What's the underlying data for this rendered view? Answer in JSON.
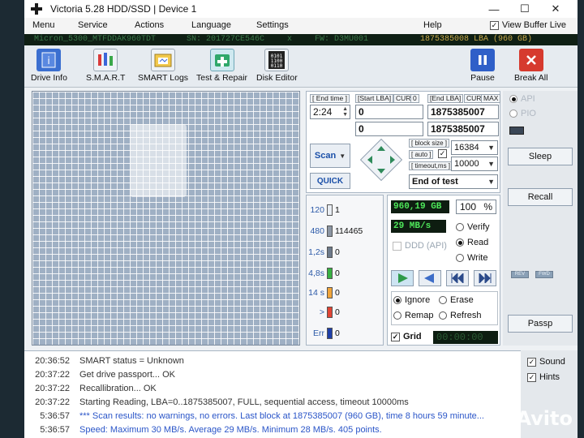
{
  "window": {
    "title": "Victoria 5.28 HDD/SSD | Device 1",
    "buttons": [
      "—",
      "☐",
      "✕"
    ]
  },
  "menu": [
    "Menu",
    "Service",
    "Actions",
    "Language",
    "Settings",
    "Help"
  ],
  "view_buffer": {
    "label": "View Buffer Live",
    "checked": true
  },
  "device": {
    "model": "Micron_5300_MTFDDAK960TDT",
    "serial": "SN: 201727CE546C",
    "sep": "x",
    "firmware": "FW: D3MU001",
    "lba": "1875385008 LBA (960 GB)"
  },
  "toolbar": {
    "drive_info": "Drive Info",
    "smart": "S.M.A.R.T",
    "smart_logs": "SMART Logs",
    "test_repair": "Test & Repair",
    "disk_editor": "Disk Editor",
    "pause": "Pause",
    "break_all": "Break All"
  },
  "controls": {
    "end_time_label": "[ End time ]",
    "end_time_value": "2:24",
    "start_lba_label": "[Start LBA]",
    "cur_label": "CUR",
    "start_cur_value": "0",
    "end_lba_label": "[End LBA]",
    "max_label": "MAX",
    "start_lba_value": "0",
    "end_lba_value": "1875385007",
    "cur_value": "0",
    "end_lba_cur_value": "1875385007",
    "scan_button": "Scan",
    "quick_button": "QUICK",
    "block_size_label": "[ block size ]",
    "auto_label": "[ auto ]",
    "block_size_value": "16384",
    "timeout_label": "[ timeout,ms ]",
    "timeout_value": "10000",
    "end_action": "End of test"
  },
  "stats": [
    {
      "label": "120",
      "color": "#e8edf3",
      "value": "1"
    },
    {
      "label": "480",
      "color": "#8c96a3",
      "value": "114465"
    },
    {
      "label": "1,2s",
      "color": "#6d7a8a",
      "value": "0"
    },
    {
      "label": "4,8s",
      "color": "#38b043",
      "value": "0"
    },
    {
      "label": "14 s",
      "color": "#f0a43a",
      "value": "0"
    },
    {
      "label": ">",
      "color": "#e04434",
      "value": "0"
    },
    {
      "label": "Err",
      "color": "#1e3fa8",
      "value": "0"
    }
  ],
  "info": {
    "size": "960,19 GB",
    "percent": "100",
    "percent_sign": "%",
    "speed": "29 MB/s",
    "ddd_api": "DDD (API)",
    "mode_verify": "Verify",
    "mode_read": "Read",
    "mode_write": "Write",
    "action_ignore": "Ignore",
    "action_erase": "Erase",
    "action_remap": "Remap",
    "action_refresh": "Refresh",
    "grid_label": "Grid",
    "timer": "00:00:00"
  },
  "right_panel": {
    "api": "API",
    "pio": "PIO",
    "sleep": "Sleep",
    "recall": "Recall",
    "mini1": "REV",
    "mini2": "FWD",
    "passp": "Passp",
    "sound": "Sound",
    "hints": "Hints"
  },
  "log": [
    {
      "time": "20:36:52",
      "msg": "SMART status = Unknown",
      "blue": false
    },
    {
      "time": "20:37:22",
      "msg": "Get drive passport... OK",
      "blue": false
    },
    {
      "time": "20:37:22",
      "msg": "Recallibration... OK",
      "blue": false
    },
    {
      "time": "20:37:22",
      "msg": "Starting Reading, LBA=0..1875385007, FULL, sequential access, timeout 10000ms",
      "blue": false
    },
    {
      "time": "5:36:57",
      "msg": "*** Scan results: no warnings, no errors. Last block at 1875385007 (960 GB), time 8 hours 59 minute...",
      "blue": true
    },
    {
      "time": "5:36:57",
      "msg": "Speed: Maximum 30 MB/s. Average 29 MB/s. Minimum 28 MB/s. 405 points.",
      "blue": true
    }
  ],
  "watermark": "Avito",
  "colors": {
    "accent": "#1a4fa8",
    "lcd_bg": "#0e1d11",
    "lcd_fg": "#4ee85a"
  }
}
